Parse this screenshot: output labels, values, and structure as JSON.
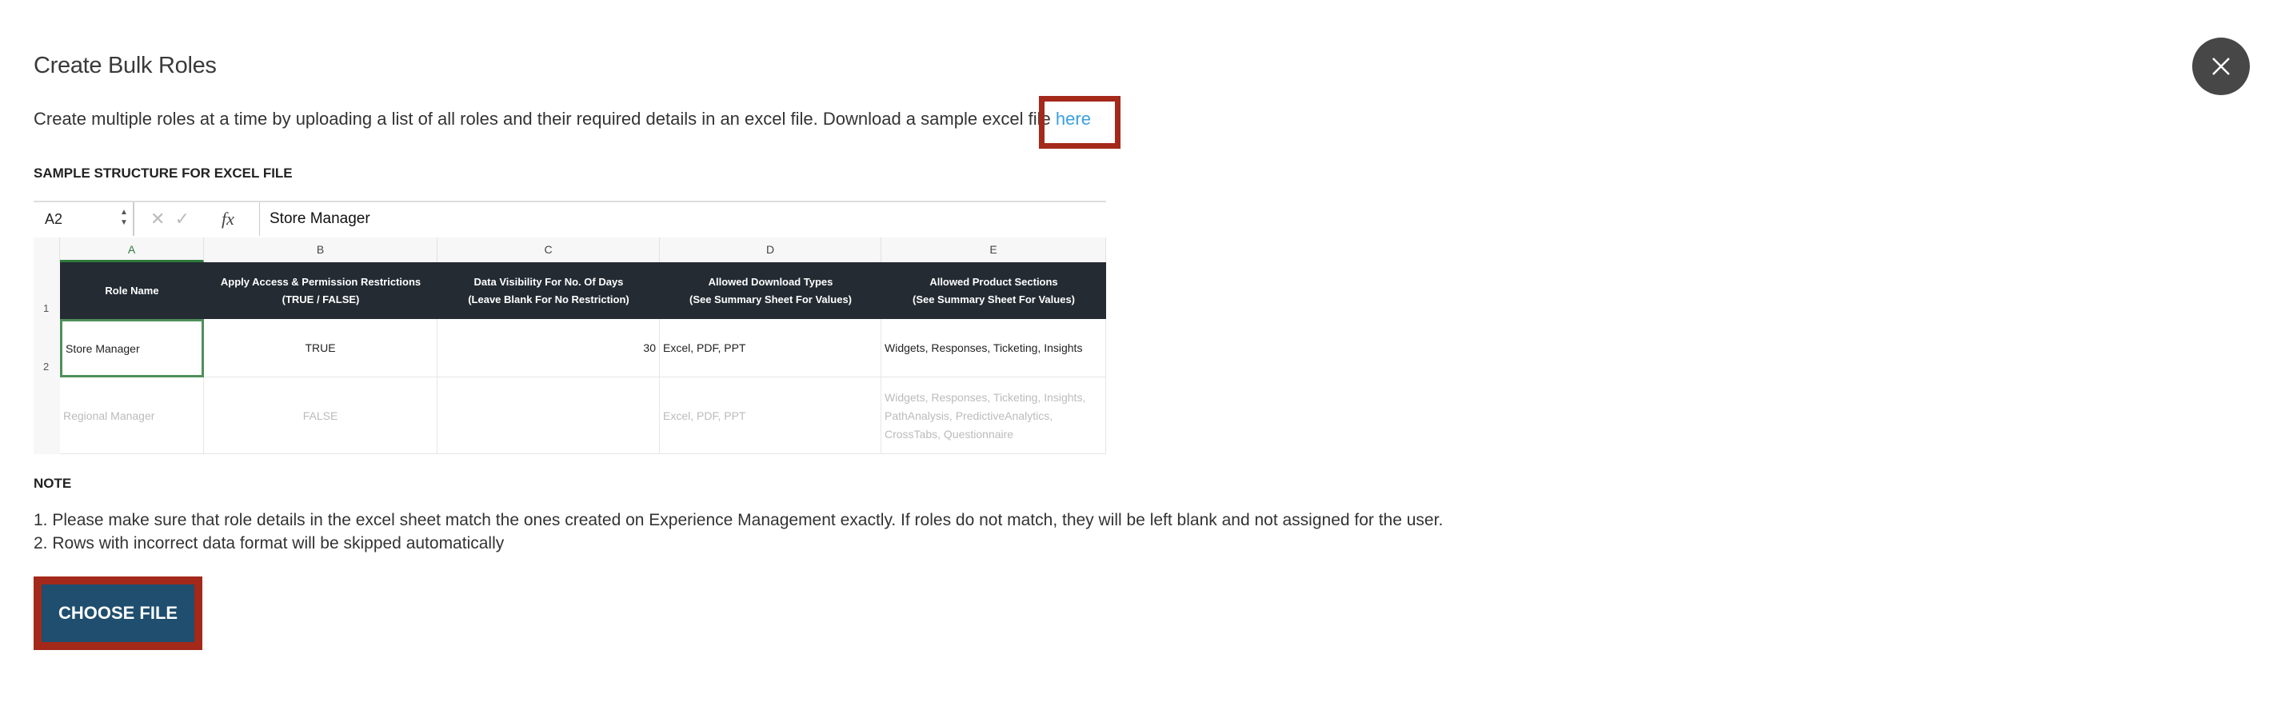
{
  "dialog": {
    "title": "Create Bulk Roles",
    "description": "Create multiple roles at a time by uploading a list of all roles and their required details in an excel file. Download a sample excel file ",
    "download_link": "here",
    "sample_heading": "SAMPLE STRUCTURE FOR EXCEL FILE",
    "note_heading": "NOTE",
    "notes": [
      "1. Please make sure that role details in the excel sheet match the ones created on Experience Management exactly. If roles do not match, they will be left blank and not assigned for the user.",
      "2. Rows with incorrect data format will be skipped automatically"
    ],
    "choose_file_label": "CHOOSE FILE",
    "close_icon": "close-icon",
    "highlight_color": "#a4291a",
    "button_color": "#1f4e6e",
    "link_color": "#3aa0e0"
  },
  "sheet": {
    "cell_ref": "A2",
    "formula_value": "Store Manager",
    "fx": "fx",
    "column_letters": [
      "A",
      "B",
      "C",
      "D",
      "E"
    ],
    "row_numbers": [
      "1",
      "2"
    ],
    "headers": [
      [
        "Role Name",
        ""
      ],
      [
        "Apply Access & Permission Restrictions",
        "(TRUE / FALSE)"
      ],
      [
        "Data Visibility For No. Of Days",
        "(Leave Blank For No Restriction)"
      ],
      [
        "Allowed Download Types",
        "(See Summary Sheet For Values)"
      ],
      [
        "Allowed Product Sections",
        "(See Summary Sheet For Values)"
      ]
    ],
    "rows": [
      [
        "Store Manager",
        "TRUE",
        "30",
        "Excel, PDF, PPT",
        "Widgets, Responses, Ticketing, Insights"
      ],
      [
        "Regional Manager",
        "FALSE",
        "",
        "Excel, PDF, PPT",
        "Widgets, Responses, Ticketing, Insights, PathAnalysis, PredictiveAnalytics, CrossTabs, Questionnaire"
      ]
    ]
  }
}
